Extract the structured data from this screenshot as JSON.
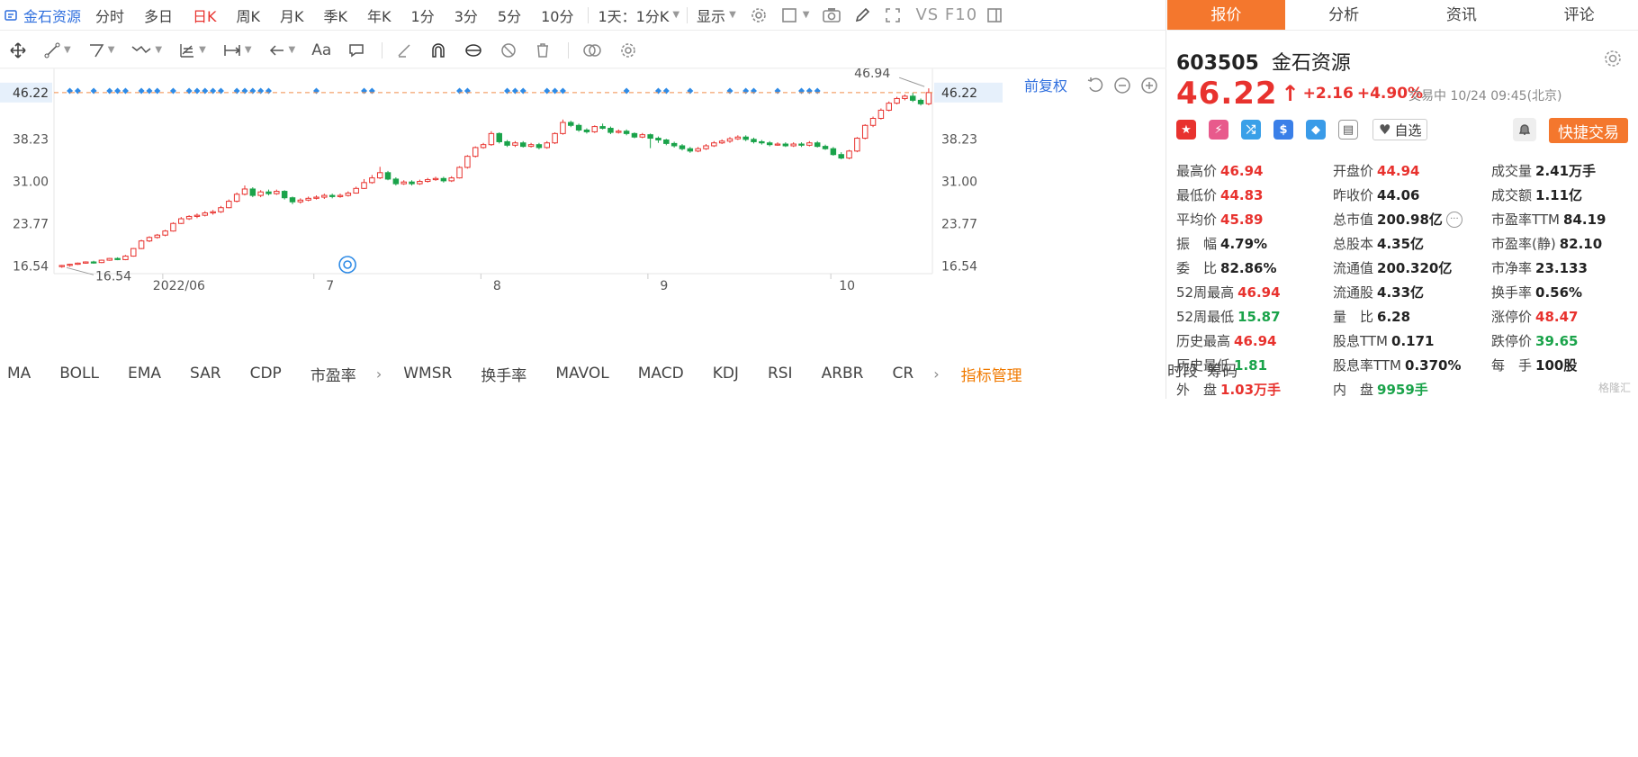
{
  "topbar": {
    "stock_name": "金石资源",
    "periods": [
      {
        "label": "分时",
        "active": false
      },
      {
        "label": "多日",
        "active": false
      },
      {
        "label": "日K",
        "active": true
      },
      {
        "label": "周K",
        "active": false
      },
      {
        "label": "月K",
        "active": false
      },
      {
        "label": "季K",
        "active": false
      },
      {
        "label": "年K",
        "active": false
      },
      {
        "label": "1分",
        "active": false
      },
      {
        "label": "3分",
        "active": false
      },
      {
        "label": "5分",
        "active": false
      },
      {
        "label": "10分",
        "active": false
      }
    ],
    "interval_select": "1天：1分K",
    "display_label": "显示",
    "vs_label": "VS F10"
  },
  "toolbar2": {
    "text_tool": "Aa"
  },
  "chart_controls": {
    "adjust_label": "前复权"
  },
  "chart_data": {
    "type": "candlestick",
    "x_tick_labels": [
      "2022/06",
      "7",
      "8",
      "9",
      "10"
    ],
    "y_tick_labels": [
      "38.23",
      "31.00",
      "23.77",
      "16.54"
    ],
    "current_price_label": "46.22",
    "high_marker": "46.94",
    "low_marker": "16.54",
    "ylim": [
      15.2,
      48.2
    ],
    "candles": [
      [
        16.4,
        16.6,
        16.7,
        16.2
      ],
      [
        16.6,
        16.8,
        16.9,
        16.4
      ],
      [
        16.8,
        17.0,
        17.1,
        16.7
      ],
      [
        17.0,
        17.2,
        17.3,
        16.9
      ],
      [
        17.2,
        17.1,
        17.4,
        16.9
      ],
      [
        17.1,
        17.5,
        17.6,
        17.0
      ],
      [
        17.5,
        17.8,
        17.9,
        17.4
      ],
      [
        17.8,
        17.6,
        18.0,
        17.5
      ],
      [
        17.6,
        18.2,
        18.4,
        17.5
      ],
      [
        18.2,
        19.5,
        19.6,
        18.1
      ],
      [
        19.5,
        20.8,
        21.0,
        19.4
      ],
      [
        20.8,
        21.4,
        21.6,
        20.6
      ],
      [
        21.4,
        21.8,
        22.0,
        21.2
      ],
      [
        21.8,
        22.5,
        22.7,
        21.6
      ],
      [
        22.5,
        23.8,
        24.0,
        22.4
      ],
      [
        23.8,
        24.6,
        24.9,
        23.7
      ],
      [
        24.6,
        25.0,
        25.2,
        24.4
      ],
      [
        25.0,
        25.2,
        25.5,
        24.7
      ],
      [
        25.2,
        25.6,
        25.9,
        25.0
      ],
      [
        25.6,
        25.8,
        26.1,
        25.3
      ],
      [
        25.8,
        26.5,
        26.8,
        25.6
      ],
      [
        26.5,
        27.6,
        27.9,
        26.4
      ],
      [
        27.6,
        28.8,
        29.1,
        27.4
      ],
      [
        28.8,
        29.7,
        30.3,
        28.6
      ],
      [
        29.7,
        28.6,
        30.0,
        28.3
      ],
      [
        28.6,
        29.2,
        29.5,
        28.3
      ],
      [
        29.2,
        28.9,
        29.6,
        28.6
      ],
      [
        28.9,
        29.3,
        29.6,
        28.7
      ],
      [
        29.3,
        28.2,
        29.5,
        27.9
      ],
      [
        28.2,
        27.5,
        28.4,
        27.1
      ],
      [
        27.5,
        27.8,
        28.1,
        27.2
      ],
      [
        27.8,
        28.1,
        28.4,
        27.6
      ],
      [
        28.1,
        28.3,
        28.6,
        27.9
      ],
      [
        28.3,
        28.6,
        28.9,
        28.0
      ],
      [
        28.6,
        28.4,
        28.9,
        28.1
      ],
      [
        28.4,
        28.6,
        28.9,
        28.2
      ],
      [
        28.6,
        29.0,
        29.3,
        28.4
      ],
      [
        29.0,
        29.8,
        30.1,
        28.9
      ],
      [
        29.8,
        30.8,
        31.4,
        29.7
      ],
      [
        30.8,
        31.6,
        32.1,
        30.6
      ],
      [
        31.6,
        32.5,
        33.5,
        31.4
      ],
      [
        32.5,
        31.4,
        32.8,
        31.2
      ],
      [
        31.4,
        30.6,
        31.7,
        30.3
      ],
      [
        30.6,
        30.9,
        31.2,
        30.4
      ],
      [
        30.9,
        30.6,
        31.2,
        30.3
      ],
      [
        30.6,
        31.0,
        31.3,
        30.4
      ],
      [
        31.0,
        31.3,
        31.6,
        30.8
      ],
      [
        31.3,
        31.5,
        31.8,
        31.1
      ],
      [
        31.5,
        31.1,
        31.8,
        30.8
      ],
      [
        31.1,
        31.6,
        31.9,
        30.9
      ],
      [
        31.6,
        33.4,
        33.6,
        31.5
      ],
      [
        33.4,
        35.3,
        35.5,
        33.2
      ],
      [
        35.3,
        36.8,
        37.0,
        35.1
      ],
      [
        36.8,
        37.3,
        37.6,
        36.6
      ],
      [
        37.3,
        39.2,
        39.6,
        37.1
      ],
      [
        39.2,
        37.8,
        39.4,
        37.5
      ],
      [
        37.8,
        37.2,
        38.1,
        36.9
      ],
      [
        37.2,
        37.6,
        37.9,
        36.9
      ],
      [
        37.6,
        37.0,
        37.9,
        36.8
      ],
      [
        37.0,
        37.3,
        37.6,
        36.8
      ],
      [
        37.3,
        36.8,
        37.6,
        36.5
      ],
      [
        36.8,
        37.6,
        37.9,
        36.6
      ],
      [
        37.6,
        39.2,
        39.4,
        37.4
      ],
      [
        39.2,
        41.1,
        41.6,
        39.0
      ],
      [
        41.1,
        40.6,
        41.4,
        40.3
      ],
      [
        40.6,
        39.8,
        40.9,
        39.5
      ],
      [
        39.8,
        39.5,
        40.1,
        39.2
      ],
      [
        39.5,
        40.4,
        40.6,
        39.3
      ],
      [
        40.4,
        40.1,
        40.9,
        39.9
      ],
      [
        40.1,
        39.4,
        40.4,
        39.1
      ],
      [
        39.4,
        39.6,
        39.9,
        39.2
      ],
      [
        39.6,
        39.2,
        39.9,
        38.9
      ],
      [
        39.2,
        38.6,
        39.4,
        38.4
      ],
      [
        38.6,
        39.0,
        39.3,
        38.4
      ],
      [
        39.0,
        38.4,
        39.2,
        36.7
      ],
      [
        38.4,
        38.1,
        38.7,
        37.6
      ],
      [
        38.1,
        37.5,
        38.3,
        37.2
      ],
      [
        37.5,
        37.1,
        37.8,
        36.8
      ],
      [
        37.1,
        36.6,
        37.4,
        36.3
      ],
      [
        36.6,
        36.2,
        36.9,
        35.9
      ],
      [
        36.2,
        36.6,
        36.9,
        36.0
      ],
      [
        36.6,
        37.1,
        37.4,
        36.4
      ],
      [
        37.1,
        37.6,
        37.9,
        36.9
      ],
      [
        37.6,
        37.9,
        38.2,
        37.4
      ],
      [
        37.9,
        38.3,
        38.6,
        37.6
      ],
      [
        38.3,
        38.6,
        38.9,
        38.1
      ],
      [
        38.6,
        38.2,
        38.9,
        37.9
      ],
      [
        38.2,
        37.8,
        38.5,
        37.5
      ],
      [
        37.8,
        37.6,
        38.1,
        37.3
      ],
      [
        37.6,
        37.3,
        37.9,
        37.0
      ],
      [
        37.3,
        37.4,
        37.7,
        37.1
      ],
      [
        37.4,
        37.1,
        37.7,
        36.9
      ],
      [
        37.1,
        37.4,
        37.7,
        36.9
      ],
      [
        37.4,
        37.2,
        37.7,
        36.9
      ],
      [
        37.2,
        37.6,
        37.9,
        37.0
      ],
      [
        37.6,
        37.0,
        37.9,
        36.8
      ],
      [
        37.0,
        36.6,
        37.3,
        36.4
      ],
      [
        36.6,
        35.6,
        36.9,
        35.4
      ],
      [
        35.6,
        35.0,
        36.0,
        34.8
      ],
      [
        35.0,
        36.2,
        36.4,
        34.8
      ],
      [
        36.2,
        38.4,
        38.6,
        36.0
      ],
      [
        38.4,
        40.6,
        40.8,
        38.2
      ],
      [
        40.6,
        41.8,
        42.1,
        40.3
      ],
      [
        41.8,
        43.2,
        43.5,
        41.6
      ],
      [
        43.2,
        44.4,
        44.7,
        43.0
      ],
      [
        44.4,
        45.2,
        45.5,
        44.2
      ],
      [
        45.2,
        45.6,
        45.9,
        44.9
      ],
      [
        45.6,
        44.9,
        46.2,
        44.6
      ],
      [
        44.9,
        44.3,
        45.2,
        44.0
      ],
      [
        44.3,
        46.22,
        46.94,
        44.06
      ]
    ]
  },
  "indicators": {
    "items": [
      "MA",
      "BOLL",
      "EMA",
      "SAR",
      "CDP",
      "市盈率",
      "WMSR",
      "换手率",
      "MAVOL",
      "MACD",
      "KDJ",
      "RSI",
      "ARBR",
      "CR"
    ],
    "manage_label": "指标管理",
    "right_items": [
      "时段",
      "筹码"
    ]
  },
  "panel": {
    "tabs": [
      {
        "label": "报价",
        "active": true
      },
      {
        "label": "分析",
        "active": false
      },
      {
        "label": "资讯",
        "active": false
      },
      {
        "label": "评论",
        "active": false
      }
    ],
    "code": "603505",
    "name": "金石资源",
    "price": "46.22",
    "change": "+2.16",
    "change_pct": "+4.90%",
    "status": "交易中 10/24 09:45(北京)",
    "watch_label": "自选",
    "trade_label": "快捷交易",
    "stats": [
      [
        {
          "label": "最高价",
          "value": "46.94",
          "color": "up"
        },
        {
          "label": "开盘价",
          "value": "44.94",
          "color": "up"
        },
        {
          "label": "成交量",
          "value": "2.41万手",
          "color": "normal"
        }
      ],
      [
        {
          "label": "最低价",
          "value": "44.83",
          "color": "up"
        },
        {
          "label": "昨收价",
          "value": "44.06",
          "color": "normal"
        },
        {
          "label": "成交额",
          "value": "1.11亿",
          "color": "normal"
        }
      ],
      [
        {
          "label": "平均价",
          "value": "45.89",
          "color": "up"
        },
        {
          "label": "总市值",
          "value": "200.98亿",
          "color": "normal"
        },
        {
          "label": "市盈率TTM",
          "value": "84.19",
          "color": "normal"
        }
      ],
      [
        {
          "label": "振　幅",
          "value": "4.79%",
          "color": "normal"
        },
        {
          "label": "总股本",
          "value": "4.35亿",
          "color": "normal"
        },
        {
          "label": "市盈率(静)",
          "value": "82.10",
          "color": "normal"
        }
      ],
      [
        {
          "label": "委　比",
          "value": "82.86%",
          "color": "normal"
        },
        {
          "label": "流通值",
          "value": "200.320亿",
          "color": "normal"
        },
        {
          "label": "市净率",
          "value": "23.133",
          "color": "normal"
        }
      ],
      [
        {
          "label": "52周最高",
          "value": "46.94",
          "color": "up"
        },
        {
          "label": "流通股",
          "value": "4.33亿",
          "color": "normal"
        },
        {
          "label": "换手率",
          "value": "0.56%",
          "color": "normal"
        }
      ],
      [
        {
          "label": "52周最低",
          "value": "15.87",
          "color": "down"
        },
        {
          "label": "量　比",
          "value": "6.28",
          "color": "normal"
        },
        {
          "label": "涨停价",
          "value": "48.47",
          "color": "up"
        }
      ],
      [
        {
          "label": "历史最高",
          "value": "46.94",
          "color": "up"
        },
        {
          "label": "股息TTM",
          "value": "0.171",
          "color": "normal"
        },
        {
          "label": "跌停价",
          "value": "39.65",
          "color": "down"
        }
      ],
      [
        {
          "label": "历史最低",
          "value": "1.81",
          "color": "down"
        },
        {
          "label": "股息率TTM",
          "value": "0.370%",
          "color": "normal"
        },
        {
          "label": "每　手",
          "value": "100股",
          "color": "normal"
        }
      ],
      [
        {
          "label": "外　盘",
          "value": "1.03万手",
          "color": "up"
        },
        {
          "label": "内　盘",
          "value": "9959手",
          "color": "down"
        },
        {
          "label": "",
          "value": "",
          "color": "normal"
        }
      ]
    ],
    "watermark": "格隆汇"
  },
  "colors": {
    "up": "#e8322e",
    "down": "#1aa34a",
    "accent": "#f4772d",
    "link": "#2f6fde",
    "signal": "#2f8be6"
  }
}
